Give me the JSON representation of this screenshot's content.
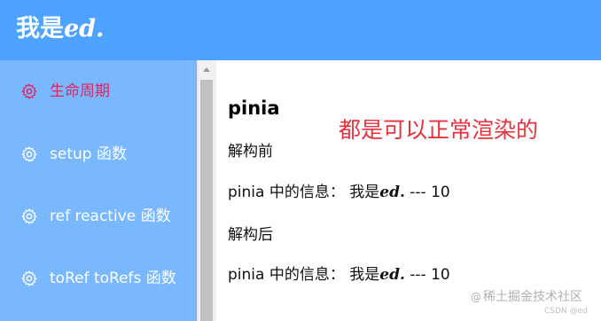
{
  "header": {
    "brand_prefix": "我是",
    "brand_emph": "ed."
  },
  "sidebar": {
    "items": [
      {
        "label": "生命周期",
        "icon": "gear-icon",
        "active": true
      },
      {
        "label": "setup 函数",
        "icon": "gear-icon",
        "active": false
      },
      {
        "label": "ref reactive 函数",
        "icon": "gear-icon",
        "active": false
      },
      {
        "label": "toRef toRefs 函数",
        "icon": "gear-icon",
        "active": false
      }
    ]
  },
  "main": {
    "title": "pinia",
    "annotation": "都是可以正常渲染的",
    "before_label": "解构前",
    "info_prefix": "pinia 中的信息：  我是",
    "info_emph": "ed.",
    "info_suffix": " --- 10",
    "after_label": "解构后"
  },
  "watermark": {
    "text": "稀土掘金技术社区",
    "sub": "CSDN @ed"
  },
  "colors": {
    "header_bg": "#4da3ff",
    "sidebar_bg": "#79b8ff",
    "active_text": "#e0245e",
    "annotation": "#e8323c"
  }
}
